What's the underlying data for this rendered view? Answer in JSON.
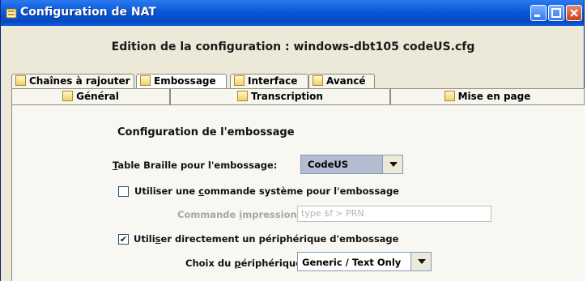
{
  "window": {
    "title": "Configuration de NAT"
  },
  "heading": "Edition de la configuration : windows-dbt105 codeUS.cfg",
  "tabs_row1": [
    "Chaînes à rajouter",
    "Embossage",
    "Interface",
    "Avancé"
  ],
  "tabs_row2": [
    "Général",
    "Transcription",
    "Mise en page"
  ],
  "active_tab": "Embossage",
  "embossage": {
    "section_title": "Configuration de l'embossage",
    "table_label_mnemonic": "T",
    "table_label_rest": "able Braille pour l'embossage:",
    "table_value": "CodeUS",
    "syscmd": {
      "checked": false,
      "label_pre": "Utiliser une ",
      "label_mnemonic": "c",
      "label_post": "ommande système pour l'embossage"
    },
    "cmd_label_pre": "Commande ",
    "cmd_label_mnemonic": "i",
    "cmd_label_post": "mpression:",
    "cmd_placeholder": "type $f > PRN",
    "direct": {
      "checked": true,
      "check_glyph": "✔",
      "label_pre": "Utili",
      "label_mnemonic": "s",
      "label_post": "er directement un périphérique d'embossage"
    },
    "periph_label_pre": "Choix du ",
    "periph_label_mnemonic": "p",
    "periph_label_post": "ériphérique:",
    "periph_value": "Generic / Text Only"
  },
  "colors": {
    "titlebar": "#0a58d8",
    "window_bg": "#ece9d8",
    "panel_bg": "#f8f7f2",
    "combo_selected": "#b4bcd0"
  }
}
